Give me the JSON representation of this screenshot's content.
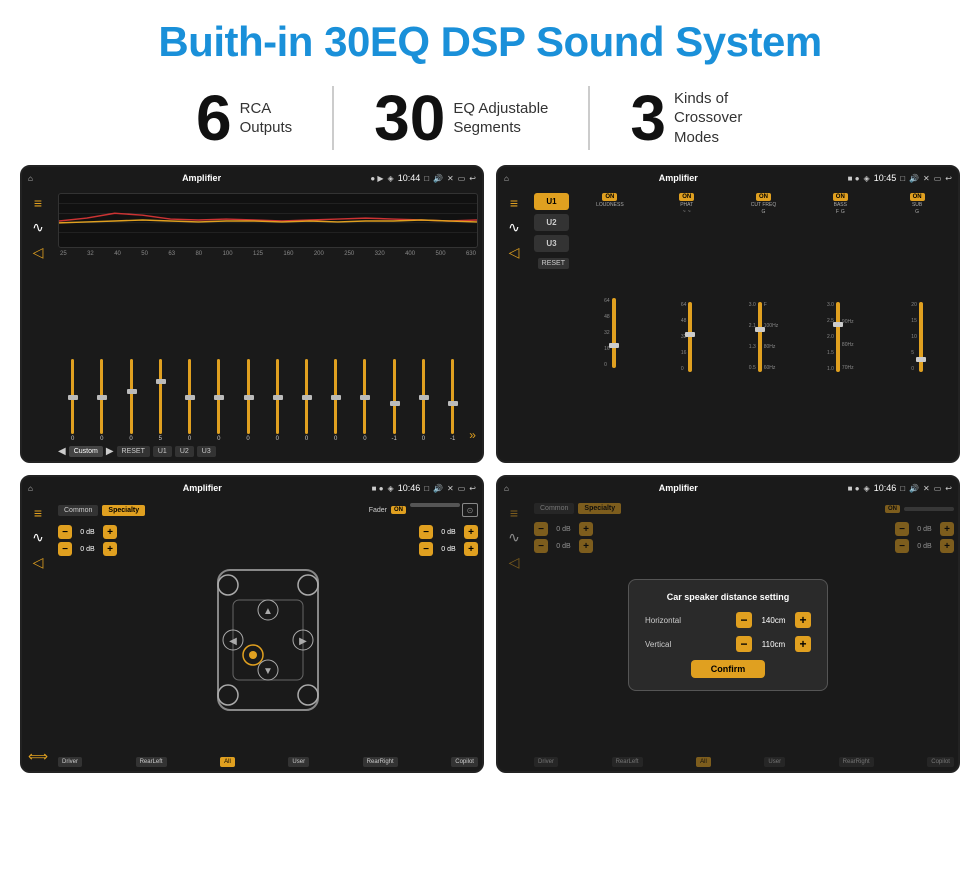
{
  "page": {
    "title": "Buith-in 30EQ DSP Sound System",
    "stats": [
      {
        "number": "6",
        "label": "RCA\nOutputs"
      },
      {
        "number": "30",
        "label": "EQ Adjustable\nSegments"
      },
      {
        "number": "3",
        "label": "Kinds of\nCrossover Modes"
      }
    ]
  },
  "screens": {
    "eq": {
      "title": "Amplifier",
      "time": "10:44",
      "freqs": [
        "25",
        "32",
        "40",
        "50",
        "63",
        "80",
        "100",
        "125",
        "160",
        "200",
        "250",
        "320",
        "400",
        "500",
        "630"
      ],
      "values": [
        "0",
        "0",
        "0",
        "5",
        "0",
        "0",
        "0",
        "0",
        "0",
        "0",
        "0",
        "-1",
        "0",
        "-1"
      ],
      "preset": "Custom",
      "buttons": [
        "RESET",
        "U1",
        "U2",
        "U3"
      ]
    },
    "crossover": {
      "title": "Amplifier",
      "time": "10:45",
      "channels": [
        "LOUDNESS",
        "PHAT",
        "CUT FREQ",
        "BASS",
        "SUB"
      ],
      "u_buttons": [
        "U1",
        "U2",
        "U3"
      ],
      "reset": "RESET"
    },
    "speaker": {
      "title": "Amplifier",
      "time": "10:46",
      "tabs": [
        "Common",
        "Specialty"
      ],
      "fader": "Fader",
      "fader_state": "ON",
      "db_values": [
        "0 dB",
        "0 dB",
        "0 dB",
        "0 dB"
      ],
      "positions": [
        "Driver",
        "RearLeft",
        "All",
        "User",
        "RearRight",
        "Copilot"
      ]
    },
    "distance": {
      "title": "Amplifier",
      "time": "10:46",
      "dialog": {
        "title": "Car speaker distance setting",
        "horizontal_label": "Horizontal",
        "horizontal_value": "140cm",
        "vertical_label": "Vertical",
        "vertical_value": "110cm",
        "confirm_label": "Confirm"
      },
      "tabs": [
        "Common",
        "Specialty"
      ],
      "db_right": [
        "0 dB",
        "0 dB"
      ],
      "positions_bottom": [
        "RearLeft",
        "All",
        "User",
        "RearRight",
        "Copilot",
        "Driver"
      ]
    }
  },
  "icons": {
    "home": "⌂",
    "eq_icon": "≡",
    "wave_icon": "〜",
    "speaker_icon": "◁",
    "settings_icon": "⚙",
    "back_arrow": "↩",
    "location": "◈",
    "camera": "📷",
    "volume": "🔊",
    "close": "✕",
    "minimize": "▭",
    "play": "▶",
    "pause": "⏸",
    "prev": "◀",
    "next": "▶▶"
  }
}
